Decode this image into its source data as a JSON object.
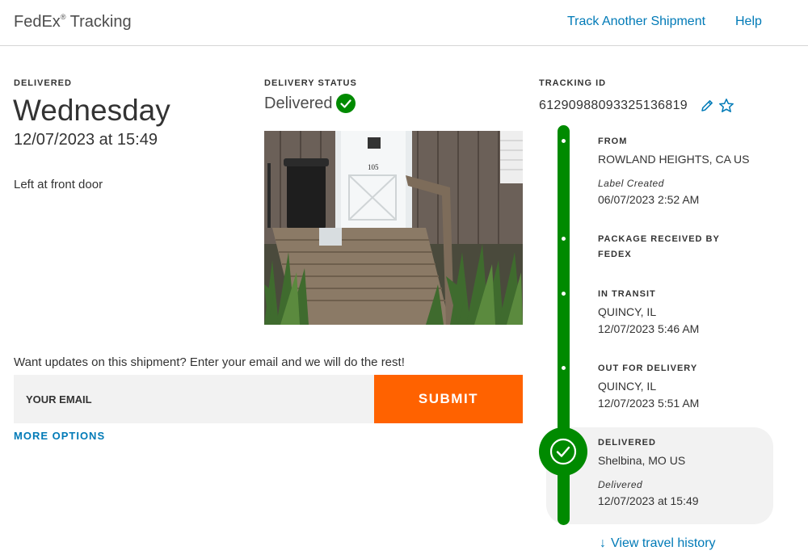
{
  "header": {
    "brand": "FedEx",
    "brand_mark": "®",
    "brand_suffix": "Tracking",
    "nav": [
      "Track Another Shipment",
      "Help"
    ]
  },
  "delivered_section": {
    "label": "DELIVERED",
    "day": "Wednesday",
    "datetime": "12/07/2023 at 15:49",
    "note": "Left at front door"
  },
  "delivery_status": {
    "label": "DELIVERY STATUS",
    "status": "Delivered"
  },
  "tracking": {
    "label": "TRACKING ID",
    "number": "612909880933251368​19"
  },
  "updates": {
    "prompt": "Want updates on this shipment? Enter your email and we will do the rest!",
    "email_placeholder": "YOUR EMAIL",
    "submit": "SUBMIT",
    "more_options": "MORE OPTIONS"
  },
  "timeline": [
    {
      "title": "FROM",
      "lines": [
        "ROWLAND HEIGHTS, CA US"
      ],
      "italic": "Label Created",
      "time": "06/07/2023 2:52 AM"
    },
    {
      "title": "PACKAGE RECEIVED BY FEDEX",
      "lines": [],
      "italic": "",
      "time": ""
    },
    {
      "title": "IN TRANSIT",
      "lines": [
        "QUINCY, IL"
      ],
      "italic": "",
      "time": "12/07/2023 5:46 AM"
    },
    {
      "title": "OUT FOR DELIVERY",
      "lines": [
        "QUINCY, IL"
      ],
      "italic": "",
      "time": "12/07/2023 5:51 AM"
    },
    {
      "title": "DELIVERED",
      "lines": [
        "Shelbina, MO US"
      ],
      "italic": "Delivered",
      "time": "12/07/2023 at 15:49"
    }
  ],
  "travel_history": "View travel history",
  "colors": {
    "accent_blue": "#007ab7",
    "orange": "#ff6200",
    "green": "#008a00"
  }
}
